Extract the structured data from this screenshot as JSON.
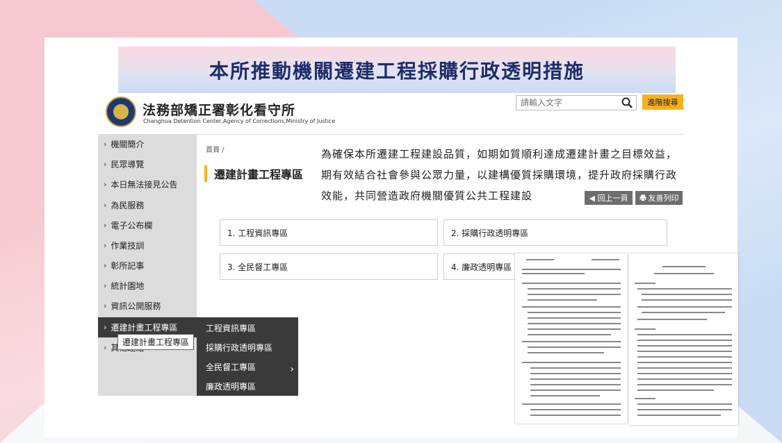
{
  "slide_title": "本所推動機關遷建工程採購行政透明措施",
  "header": {
    "org_name": "法務部矯正署彰化看守所",
    "org_name_en": "Changhua Detention Center,Agency of Corrections,Ministry of Justice",
    "search_placeholder": "請輸入文字",
    "advanced_search": "進階搜尋"
  },
  "sidebar": {
    "items": [
      {
        "label": "機關簡介"
      },
      {
        "label": "民眾導覽"
      },
      {
        "label": "本日無法接見公告"
      },
      {
        "label": "為民服務"
      },
      {
        "label": "電子公布欄"
      },
      {
        "label": "作業技訓"
      },
      {
        "label": "彰所記事"
      },
      {
        "label": "統計園地"
      },
      {
        "label": "資訊公開服務"
      },
      {
        "label": "遷建計畫工程專區"
      },
      {
        "label": "其他連結"
      }
    ],
    "tooltip": "遷建計畫工程專區"
  },
  "submenu": {
    "items": [
      "工程資訊專區",
      "採購行政透明專區",
      "全民督工專區",
      "廉政透明專區"
    ]
  },
  "main": {
    "breadcrumb": "首頁  /",
    "title": "遷建計畫工程專區",
    "intro": "為確保本所遷建工程建設品質，如期如質順利達成遷建計畫之目標效益，期有效結合社會參與公眾力量，以建構優質採購環境，提升政府採購行政效能，共同營造政府機關優質公共工程建設",
    "back_button": "◀ 回上一頁",
    "print_button": "友善列印",
    "categories": [
      "1. 工程資訊專區",
      "2. 採購行政透明專區",
      "3. 全民督工專區",
      "4. 廉政透明專區"
    ]
  }
}
